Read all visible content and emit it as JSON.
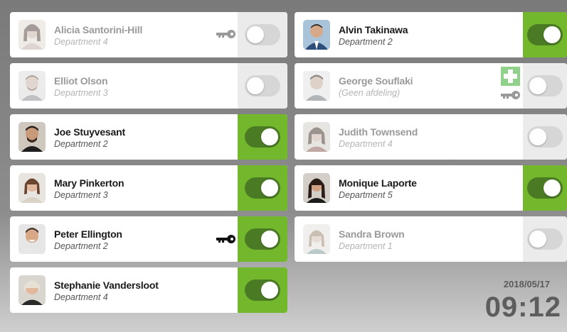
{
  "employees": [
    {
      "name": "Alicia Santorini-Hill",
      "department": "Department 4",
      "present": false,
      "key": true,
      "first_aid": false
    },
    {
      "name": "Alvin Takinawa",
      "department": "Department 2",
      "present": true,
      "key": false,
      "first_aid": false
    },
    {
      "name": "Elliot Olson",
      "department": "Department 3",
      "present": false,
      "key": false,
      "first_aid": false
    },
    {
      "name": "George Souflaki",
      "department": "(Geen afdeling)",
      "present": false,
      "key": true,
      "first_aid": true
    },
    {
      "name": "Joe Stuyvesant",
      "department": "Department 2",
      "present": true,
      "key": false,
      "first_aid": false
    },
    {
      "name": "Judith Townsend",
      "department": "Department 4",
      "present": false,
      "key": false,
      "first_aid": false
    },
    {
      "name": "Mary Pinkerton",
      "department": "Department 3",
      "present": true,
      "key": false,
      "first_aid": false
    },
    {
      "name": "Monique Laporte",
      "department": "Department 5",
      "present": true,
      "key": false,
      "first_aid": false
    },
    {
      "name": "Peter Ellington",
      "department": "Department 2",
      "present": true,
      "key": true,
      "first_aid": false
    },
    {
      "name": "Sandra Brown",
      "department": "Department 1",
      "present": false,
      "key": false,
      "first_aid": false
    },
    {
      "name": "Stephanie Vandersloot",
      "department": "Department 4",
      "present": true,
      "key": false,
      "first_aid": false
    }
  ],
  "clock": {
    "date": "2018/05/17",
    "time": "09:12"
  },
  "colors": {
    "present_accent": "#72b72c",
    "present_toggle": "#4b7a24",
    "absent_zone": "#ebebeb",
    "first_aid": "#8fd18a"
  },
  "icons": {
    "key": "key-icon",
    "first_aid": "first-aid-cross-icon",
    "avatar": "avatar-photo"
  }
}
